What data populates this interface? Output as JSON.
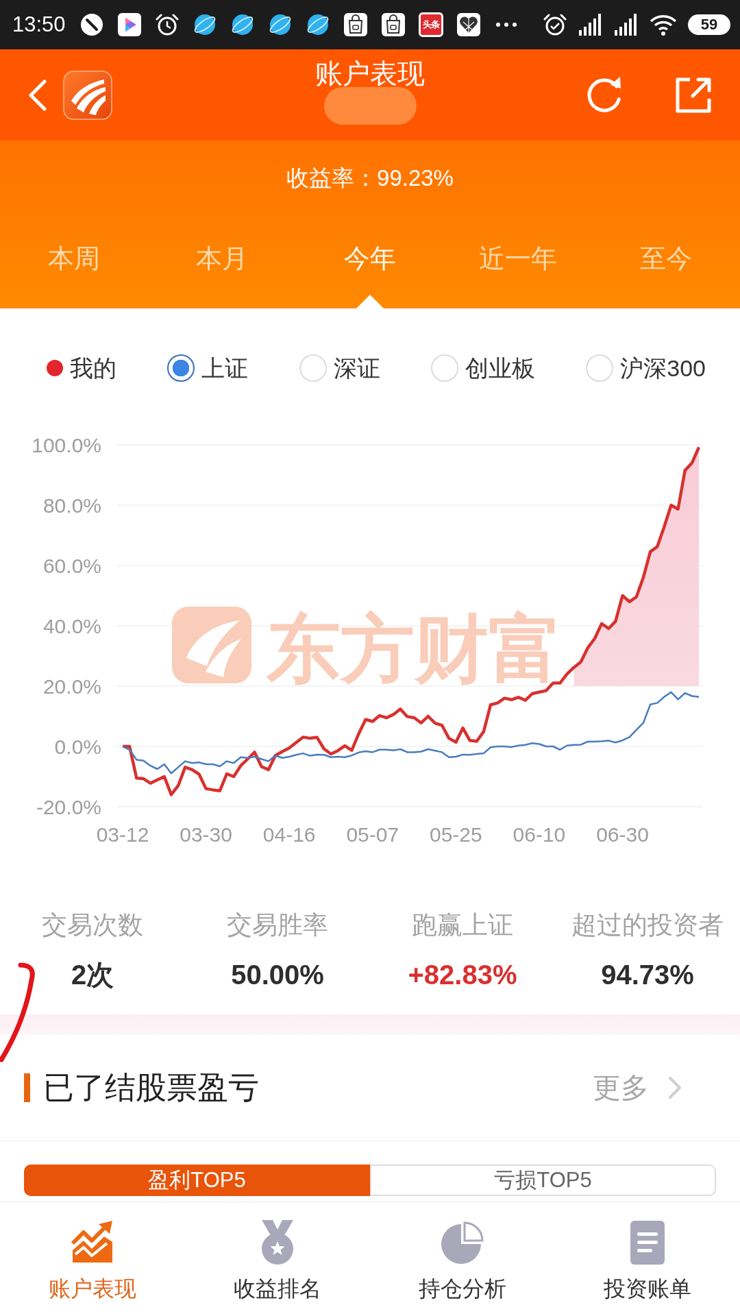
{
  "status_bar": {
    "time": "13:50",
    "news_app_label": "头条",
    "battery": "59"
  },
  "header": {
    "title": "账户表现"
  },
  "summary": {
    "text": "收益率：99.23%"
  },
  "period_tabs": [
    {
      "label": "本周",
      "selected": false
    },
    {
      "label": "本月",
      "selected": false
    },
    {
      "label": "今年",
      "selected": true
    },
    {
      "label": "近一年",
      "selected": false
    },
    {
      "label": "至今",
      "selected": false
    }
  ],
  "legend": [
    {
      "kind": "dot",
      "label": "我的"
    },
    {
      "kind": "radio",
      "label": "上证",
      "selected": true
    },
    {
      "kind": "radio",
      "label": "深证",
      "selected": false
    },
    {
      "kind": "radio",
      "label": "创业板",
      "selected": false
    },
    {
      "kind": "radio",
      "label": "沪深300",
      "selected": false
    }
  ],
  "chart": {
    "watermark": "东方财富",
    "chart_data": {
      "type": "line",
      "grid": true,
      "categories": [
        "03-12",
        null,
        null,
        null,
        null,
        null,
        null,
        null,
        null,
        null,
        null,
        null,
        "03-30",
        null,
        null,
        null,
        null,
        null,
        null,
        null,
        null,
        null,
        null,
        null,
        "04-16",
        null,
        null,
        null,
        null,
        null,
        null,
        null,
        null,
        null,
        null,
        null,
        "05-07",
        null,
        null,
        null,
        null,
        null,
        null,
        null,
        null,
        null,
        null,
        null,
        "05-25",
        null,
        null,
        null,
        null,
        null,
        null,
        null,
        null,
        null,
        null,
        null,
        "06-10",
        null,
        null,
        null,
        null,
        null,
        null,
        null,
        null,
        null,
        null,
        null,
        "06-30",
        null,
        null,
        null,
        null,
        null,
        null,
        null,
        null,
        null,
        null,
        null
      ],
      "ylim": [
        -20,
        100
      ],
      "yticks": [
        {
          "value": -20,
          "label": "-20.0%"
        },
        {
          "value": 0,
          "label": "0.0%"
        },
        {
          "value": 20,
          "label": "20.0%"
        },
        {
          "value": 40,
          "label": "40.0%"
        },
        {
          "value": 60,
          "label": "60.0%"
        },
        {
          "value": 80,
          "label": "80.0%"
        },
        {
          "value": 100,
          "label": "100.0%"
        }
      ],
      "series": [
        {
          "color": "#d7312f",
          "values": [
            0,
            0,
            -10.5,
            -10.7,
            -12.2,
            -11.1,
            -10,
            -16,
            -13,
            -6.9,
            -7.7,
            -9.2,
            -14,
            -14.4,
            -14.7,
            -9.1,
            -10,
            -6.4,
            -4.2,
            -1.9,
            -6.7,
            -7.7,
            -3,
            -1.7,
            -0.5,
            1.3,
            3.1,
            2.7,
            3,
            -0.8,
            -2.5,
            -1.4,
            0.2,
            -1.3,
            4.2,
            8.9,
            8.3,
            10.2,
            9.5,
            10.6,
            12.4,
            9.9,
            9.5,
            7.8,
            10,
            7.7,
            7,
            2.7,
            1.4,
            6.1,
            2,
            1.7,
            4.9,
            13.8,
            14.4,
            16,
            15.5,
            16.3,
            15.3,
            17.5,
            18,
            18.5,
            21,
            21,
            24,
            26.2,
            28,
            32.7,
            35.8,
            40.7,
            39.1,
            41.5,
            50,
            48,
            49.6,
            56,
            64.6,
            66.2,
            72.8,
            80,
            78.7,
            91.5,
            94,
            99.2
          ]
        },
        {
          "color": "#4a7cc0",
          "values": [
            0,
            -1.1,
            -4.4,
            -4.7,
            -6.4,
            -7.5,
            -5.9,
            -8.9,
            -6.9,
            -4.9,
            -5.5,
            -5.3,
            -5.9,
            -5.9,
            -6.6,
            -4.9,
            -5.5,
            -3.6,
            -3.8,
            -3.4,
            -4.2,
            -4.9,
            -3,
            -3.8,
            -3.4,
            -2.8,
            -2.3,
            -3.1,
            -2.7,
            -2.8,
            -3.6,
            -3.4,
            -3.6,
            -3,
            -2,
            -1.6,
            -1.9,
            -1.1,
            -1.1,
            -1.3,
            -0.9,
            -1.9,
            -1.9,
            -1.7,
            -0.9,
            -1.4,
            -1.9,
            -3.6,
            -3.4,
            -2.7,
            -2.8,
            -2.5,
            -2.3,
            -0.3,
            0,
            0,
            -0.2,
            0.3,
            0.5,
            1.1,
            0.8,
            0,
            0,
            -1.1,
            0.3,
            0.5,
            0.6,
            1.6,
            1.6,
            1.7,
            1.9,
            1.3,
            2,
            3.1,
            5.5,
            7.8,
            13.9,
            14.4,
            16.4,
            18,
            15.6,
            17.7,
            16.7,
            16.4
          ]
        }
      ]
    }
  },
  "stats": [
    {
      "label": "交易次数",
      "value": "2次",
      "highlighted": false
    },
    {
      "label": "交易胜率",
      "value": "50.00%",
      "highlighted": false
    },
    {
      "label": "跑赢上证",
      "value": "+82.83%",
      "highlighted": true
    },
    {
      "label": "超过的投资者",
      "value": "94.73%",
      "highlighted": false
    }
  ],
  "closed_positions": {
    "title": "已了结股票盈亏",
    "more": "更多",
    "tabs": [
      {
        "label": "盈利TOP5",
        "selected": true
      },
      {
        "label": "亏损TOP5",
        "selected": false
      }
    ]
  },
  "bottom_nav": [
    {
      "label": "账户表现",
      "selected": true
    },
    {
      "label": "收益排名",
      "selected": false
    },
    {
      "label": "持仓分析",
      "selected": false
    },
    {
      "label": "投资账单",
      "selected": false
    }
  ]
}
